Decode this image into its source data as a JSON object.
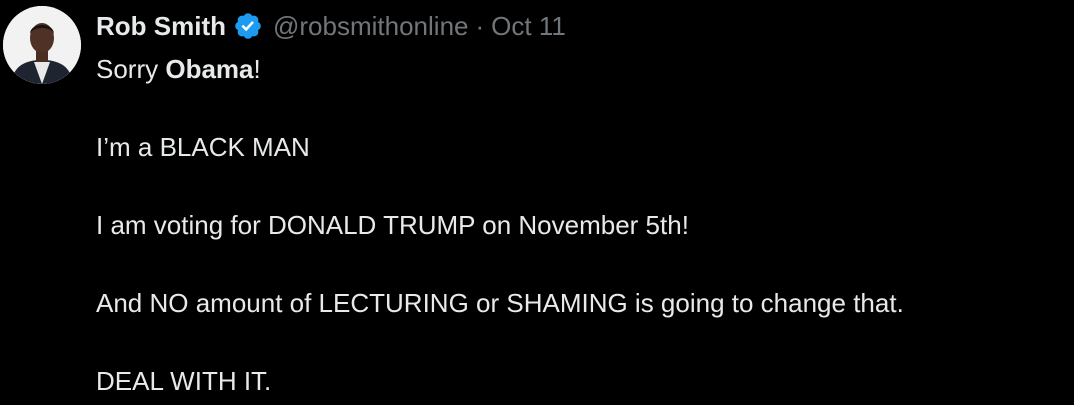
{
  "author": {
    "display_name": "Rob Smith",
    "handle": "@robsmithonline",
    "separator": "·",
    "date": "Oct 11",
    "verified_icon": "verified-badge-icon",
    "avatar_icon": "profile-photo"
  },
  "tweet": {
    "line1_prefix": "Sorry ",
    "line1_bold": "Obama",
    "line1_suffix": "!",
    "line2": "I’m a BLACK MAN",
    "line3": "I am voting for DONALD TRUMP on November 5th!",
    "line4": "And NO amount of LECTURING or SHAMING is going to change that.",
    "line5": "DEAL WITH IT."
  },
  "colors": {
    "background": "#000000",
    "text": "#e7e9ea",
    "secondary_text": "#71767b",
    "verified_blue": "#1d9bf0"
  }
}
